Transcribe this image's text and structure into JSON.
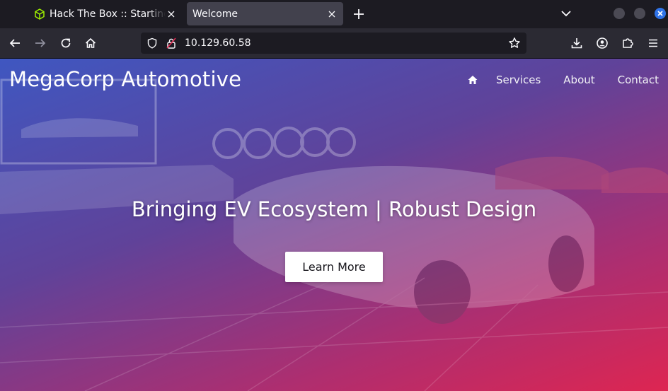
{
  "browser": {
    "tabs": [
      {
        "title": "Hack The Box :: Starting Point",
        "active": false,
        "favicon": "htb-cube-icon"
      },
      {
        "title": "Welcome",
        "active": true
      }
    ],
    "url": "10.129.60.58",
    "accent_color": "#2f73e8"
  },
  "site": {
    "brand": "MegaCorp Automotive",
    "nav": {
      "home_icon": "home-icon",
      "links": [
        "Services",
        "About",
        "Contact"
      ]
    },
    "hero": {
      "title": "Bringing EV Ecosystem | Robust Design",
      "cta_label": "Learn More"
    },
    "gradient_colors": [
      "#425cce",
      "#6948aa",
      "#be3078",
      "#e82654"
    ]
  }
}
